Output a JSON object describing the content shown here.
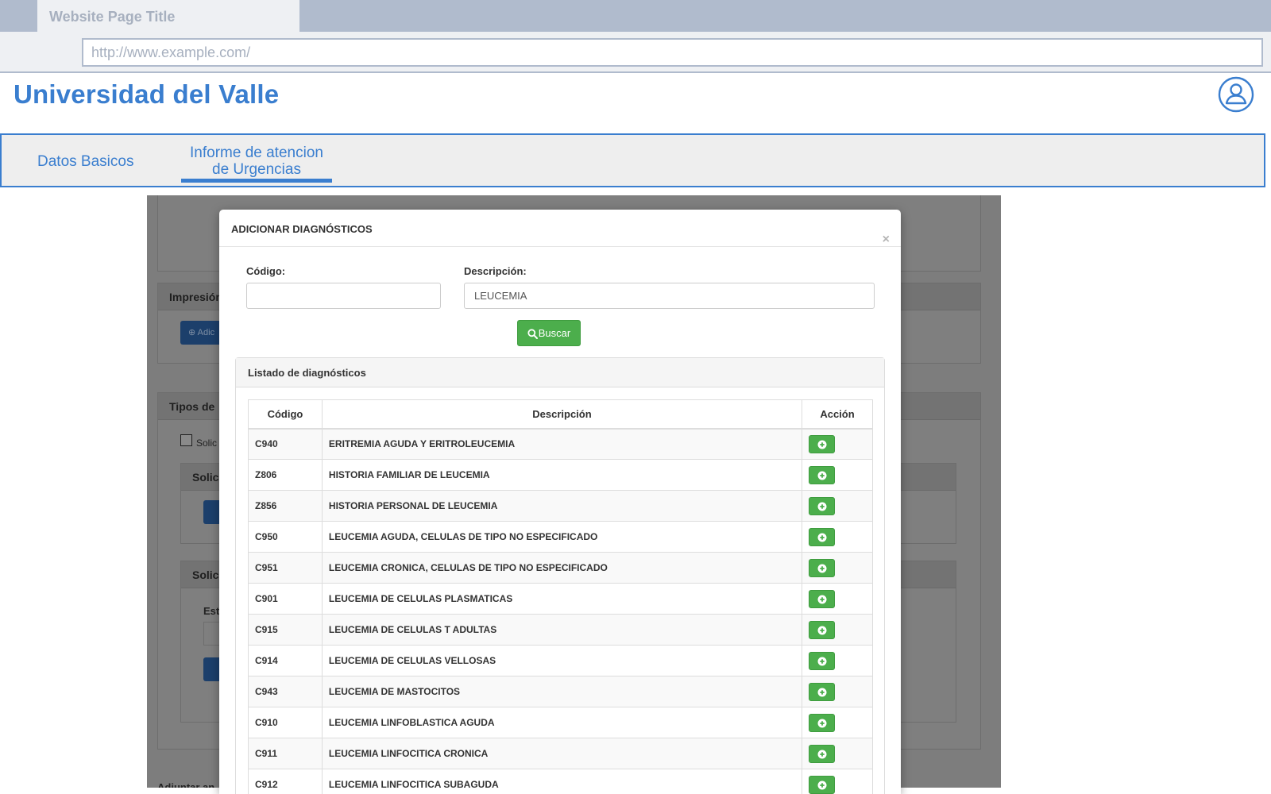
{
  "browser": {
    "tab_title": "Website Page Title",
    "url": "http://www.example.com/"
  },
  "header": {
    "site_title": "Universidad del Valle",
    "user_icon": "user-circle-icon"
  },
  "tabs": {
    "datos_basicos": "Datos Basicos",
    "informe_line1": "Informe de atencion",
    "informe_line2": "de Urgencias",
    "active": "informe"
  },
  "background": {
    "panel1_title": "Impresión",
    "panel1_button": "Adic",
    "panel2_title": "Tipos de",
    "checkbox_label": "Solic",
    "sub1_title": "Solic",
    "sub2_title": "Solic",
    "sub2_label": "Est",
    "footer_text": "Adjuntar an"
  },
  "modal": {
    "title": "ADICIONAR DIAGNÓSTICOS",
    "close_symbol": "×",
    "codigo_label": "Código:",
    "codigo_value": "",
    "descripcion_label": "Descripción:",
    "descripcion_value": "LEUCEMIA",
    "search_button": "Buscar",
    "list_title": "Listado de diagnósticos",
    "columns": {
      "code": "Código",
      "description": "Descripción",
      "action": "Acción"
    },
    "rows": [
      {
        "code": "C940",
        "description": "ERITREMIA AGUDA Y ERITROLEUCEMIA"
      },
      {
        "code": "Z806",
        "description": "HISTORIA FAMILIAR DE LEUCEMIA"
      },
      {
        "code": "Z856",
        "description": "HISTORIA PERSONAL DE LEUCEMIA"
      },
      {
        "code": "C950",
        "description": "LEUCEMIA AGUDA, CELULAS DE TIPO NO ESPECIFICADO"
      },
      {
        "code": "C951",
        "description": "LEUCEMIA CRONICA, CELULAS DE TIPO NO ESPECIFICADO"
      },
      {
        "code": "C901",
        "description": "LEUCEMIA DE CELULAS PLASMATICAS"
      },
      {
        "code": "C915",
        "description": "LEUCEMIA DE CELULAS T ADULTAS"
      },
      {
        "code": "C914",
        "description": "LEUCEMIA DE CELULAS VELLOSAS"
      },
      {
        "code": "C943",
        "description": "LEUCEMIA DE MASTOCITOS"
      },
      {
        "code": "C910",
        "description": "LEUCEMIA LINFOBLASTICA AGUDA"
      },
      {
        "code": "C911",
        "description": "LEUCEMIA LINFOCITICA CRONICA"
      },
      {
        "code": "C912",
        "description": "LEUCEMIA LINFOCITICA SUBAGUDA"
      }
    ],
    "add_icon": "plus-circle-icon"
  },
  "colors": {
    "brand_blue": "#3a7ecf",
    "success_green": "#4cae4c",
    "chrome_gray": "#b0bbcd"
  }
}
